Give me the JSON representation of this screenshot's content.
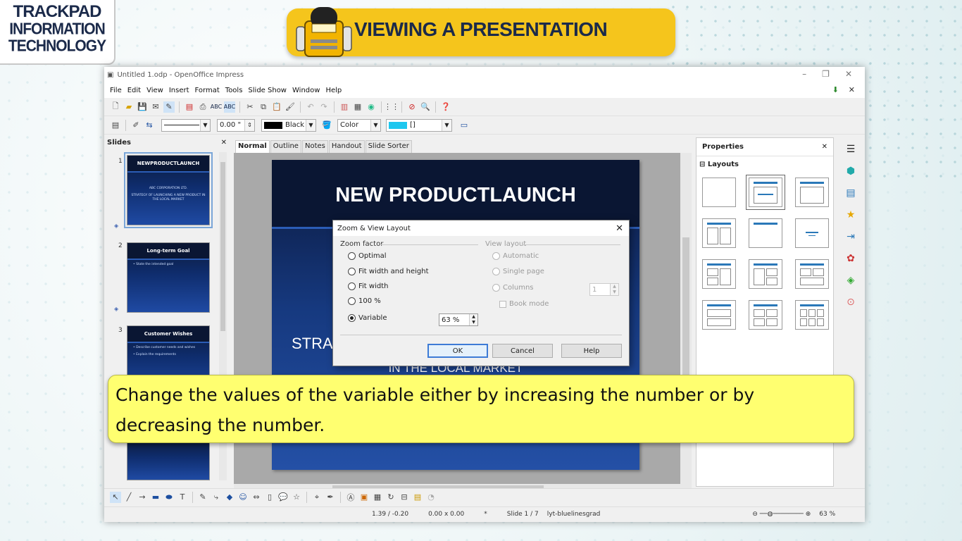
{
  "logo": {
    "line1": "TRACKPAD",
    "line2": "INFORMATION",
    "line3": "TECHNOLOGY"
  },
  "banner": {
    "title": "VIEWING A PRESENTATION"
  },
  "window": {
    "title": "Untitled 1.odp - OpenOffice Impress"
  },
  "menu": [
    "File",
    "Edit",
    "View",
    "Insert",
    "Format",
    "Tools",
    "Slide Show",
    "Window",
    "Help"
  ],
  "line_toolbar": {
    "width": "0.00 \"",
    "line_color": "Black",
    "area_style": "Color",
    "area_color": "[]"
  },
  "slides_pane": {
    "title": "Slides",
    "items": [
      {
        "num": "1",
        "title": "NEWPRODUCTLAUNCH",
        "line1": "ABC CORPORATION LTD.",
        "line2": "STRATEGY OF LAUNCHING A NEW PRODUCT IN THE LOCAL MARKET"
      },
      {
        "num": "2",
        "title": "Long-term Goal",
        "line1": "• State the intended goal",
        "line2": ""
      },
      {
        "num": "3",
        "title": "Customer Wishes",
        "line1": "• Describe customer needs and wishes",
        "line2": "• Explain the requirements"
      }
    ]
  },
  "view_tabs": [
    "Normal",
    "Outline",
    "Notes",
    "Handout",
    "Slide Sorter"
  ],
  "slide": {
    "title": "NEW PRODUCTLAUNCH",
    "body_partial": "STRA",
    "body_line2": "IN THE LOCAL MARKET"
  },
  "properties": {
    "title": "Properties",
    "section": "Layouts"
  },
  "status": {
    "position": "1.39 / -0.20",
    "size": "0.00 x 0.00",
    "modified": "*",
    "slide": "Slide 1 / 7",
    "design": "lyt-bluelinesgrad",
    "zoom": "63 %"
  },
  "dialog": {
    "title": "Zoom & View Layout",
    "zoom_factor_label": "Zoom factor",
    "view_layout_label": "View layout",
    "options": {
      "optimal": "Optimal",
      "fit_wh": "Fit width and height",
      "fit_w": "Fit width",
      "p100": "100 %",
      "variable": "Variable"
    },
    "variable_value": "63 %",
    "layout_options": {
      "automatic": "Automatic",
      "single": "Single page",
      "columns": "Columns",
      "book": "Book mode"
    },
    "columns_value": "1",
    "buttons": {
      "ok": "OK",
      "cancel": "Cancel",
      "help": "Help"
    }
  },
  "caption": {
    "text": "Change the values of the variable either by increasing the number or by decreasing the number."
  },
  "colors": {
    "banner": "#f5c51c",
    "caption": "#ffff70",
    "slide_dark": "#0a1633",
    "slide_blue": "#2450a6"
  }
}
